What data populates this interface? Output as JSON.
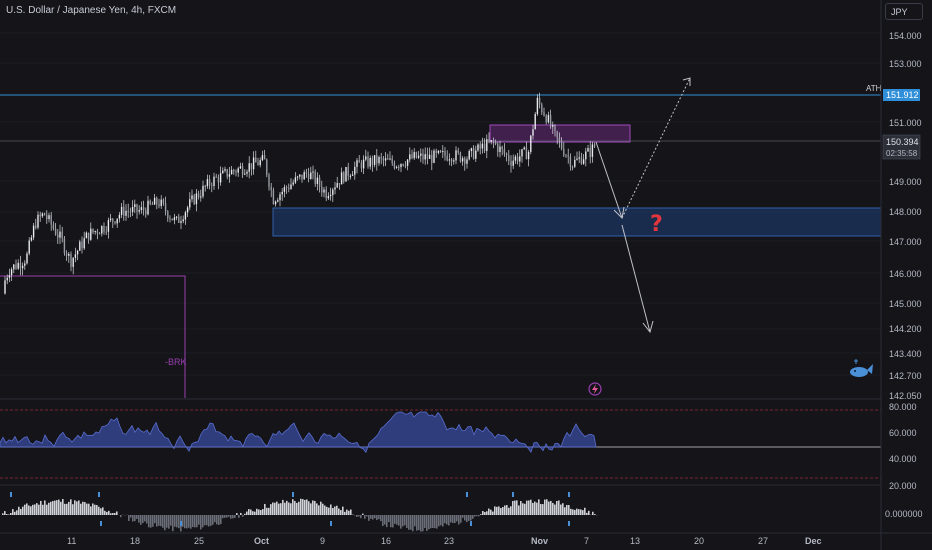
{
  "header": {
    "symbol_title": "U.S. Dollar / Japanese Yen, 4h, FXCM",
    "currency": "JPY"
  },
  "price_axis": {
    "ticks": [
      "154.000",
      "153.000",
      "151.000",
      "149.000",
      "148.000",
      "147.000",
      "146.000",
      "145.000",
      "144.200",
      "143.400",
      "142.700",
      "142.050"
    ],
    "ath_label": "ATH",
    "ath_value": "151.912",
    "current_price": "150.394",
    "countdown": "02:35:58"
  },
  "indicators": {
    "rsi_ticks": [
      "80.000",
      "60.000",
      "40.000"
    ],
    "macd_ticks": [
      "20.000",
      "0.000000"
    ]
  },
  "time_axis": {
    "labels": [
      "11",
      "18",
      "25",
      "Oct",
      "9",
      "16",
      "23",
      "Nov",
      "7",
      "13",
      "20",
      "27",
      "Dec"
    ]
  },
  "annotations": {
    "brk_label": "-BRK",
    "question_mark": "?"
  },
  "colors": {
    "background": "#141419",
    "candle": "#d9dbe0",
    "ath_line": "#2f8fd8",
    "zone_blue": "#1f3f7a",
    "zone_purple": "#7a2f8f",
    "rsi_fill": "#3a4fa8",
    "rsi_ma": "#e040a0",
    "accent_red": "#e0363c"
  },
  "chart_data": {
    "type": "candlestick",
    "price_range": [
      142.05,
      154.3
    ],
    "ath": 151.912,
    "current": 150.394,
    "demand_zone": [
      147.3,
      148.1
    ],
    "supply_zone": [
      150.4,
      150.9
    ],
    "close_path": [
      [
        0,
        145.2
      ],
      [
        0.01,
        146.0
      ],
      [
        0.03,
        146.4
      ],
      [
        0.04,
        147.6
      ],
      [
        0.05,
        147.9
      ],
      [
        0.07,
        147.0
      ],
      [
        0.08,
        146.3
      ],
      [
        0.1,
        147.2
      ],
      [
        0.12,
        147.5
      ],
      [
        0.14,
        148.0
      ],
      [
        0.16,
        148.0
      ],
      [
        0.18,
        148.3
      ],
      [
        0.2,
        147.6
      ],
      [
        0.22,
        148.4
      ],
      [
        0.24,
        149.0
      ],
      [
        0.26,
        149.3
      ],
      [
        0.28,
        149.5
      ],
      [
        0.3,
        149.7
      ],
      [
        0.31,
        148.4
      ],
      [
        0.33,
        148.9
      ],
      [
        0.35,
        149.3
      ],
      [
        0.37,
        148.6
      ],
      [
        0.39,
        149.2
      ],
      [
        0.41,
        149.6
      ],
      [
        0.43,
        149.7
      ],
      [
        0.45,
        149.6
      ],
      [
        0.47,
        149.8
      ],
      [
        0.49,
        149.8
      ],
      [
        0.51,
        149.9
      ],
      [
        0.53,
        149.8
      ],
      [
        0.55,
        150.2
      ],
      [
        0.56,
        150.3
      ],
      [
        0.58,
        149.7
      ],
      [
        0.6,
        150.0
      ],
      [
        0.61,
        151.7
      ],
      [
        0.62,
        151.2
      ],
      [
        0.63,
        150.5
      ],
      [
        0.65,
        149.6
      ],
      [
        0.67,
        150.0
      ],
      [
        0.68,
        150.4
      ]
    ]
  }
}
